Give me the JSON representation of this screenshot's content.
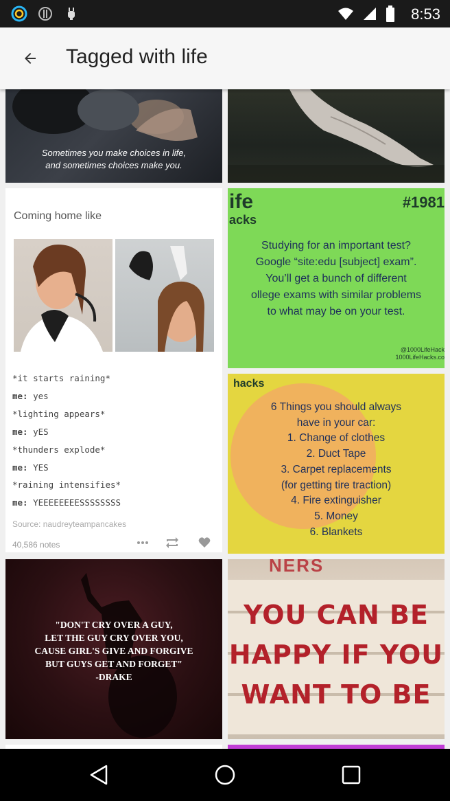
{
  "status_bar": {
    "time": "8:53",
    "icons": [
      "circle-app-icon",
      "info-icon",
      "android-icon",
      "wifi-icon",
      "signal-icon",
      "battery-icon"
    ]
  },
  "app_bar": {
    "back_icon": "arrow-left-icon",
    "title": "Tagged with life"
  },
  "tiles": {
    "t1": {
      "caption_line1": "Sometimes you make choices in life,",
      "caption_line2": "and sometimes choices make you."
    },
    "t3": {
      "title": "Coming home like",
      "lines": [
        {
          "who": "",
          "text": "*it starts raining*"
        },
        {
          "who": "me:",
          "text": " yes"
        },
        {
          "who": "",
          "text": "*lighting appears*"
        },
        {
          "who": "me:",
          "text": " yES"
        },
        {
          "who": "",
          "text": "*thunders explode*"
        },
        {
          "who": "me:",
          "text": " YES"
        },
        {
          "who": "",
          "text": "*raining intensifies*"
        },
        {
          "who": "me:",
          "text": " YEEEEEEEESSSSSSSS"
        }
      ],
      "source": "Source: naudreyteampancakes",
      "notes": "40,586 notes"
    },
    "t4": {
      "brand_line1": "ife",
      "brand_line2": "acks",
      "number": "#1981",
      "body_lines": [
        "Studying for an important test?",
        "Google “site:edu [subject] exam”.",
        "You’ll get a bunch of different",
        "ollege exams with similar problems",
        "to what may be on your test."
      ],
      "credit_line1": "@1000LifeHack",
      "credit_line2": "1000LifeHacks.co"
    },
    "t5": {
      "brand": "hacks",
      "body_lines": [
        "6 Things you should always",
        "have in your car:",
        "1. Change of clothes",
        "2. Duct Tape",
        "3. Carpet replacements",
        "(for getting tire traction)",
        "4. Fire extinguisher",
        "5. Money",
        "6. Blankets"
      ]
    },
    "t6": {
      "quote_lines": [
        "\"DON'T CRY OVER A GUY,",
        "LET THE GUY CRY OVER YOU,",
        "CAUSE GIRL'S GIVE AND FORGIVE",
        "BUT GUYS GET AND FORGET\"",
        "-DRAKE"
      ]
    },
    "t7": {
      "sign_lines": [
        "YOU CAN BE",
        "HAPPY IF YOU",
        "WANT TO BE"
      ],
      "top_letters": "NERS"
    }
  },
  "nav_bar": {
    "back_icon": "nav-back-icon",
    "home_icon": "nav-home-icon",
    "recents_icon": "nav-recents-icon"
  },
  "colors": {
    "status_bg": "#1a1a1a",
    "appbar_bg": "#f6f6f6",
    "lime_green": "#7ed957",
    "yellow": "#e4d640",
    "orange_circle": "#f0b25d",
    "maroon": "#2a0f12",
    "sign_red": "#b3212a"
  }
}
